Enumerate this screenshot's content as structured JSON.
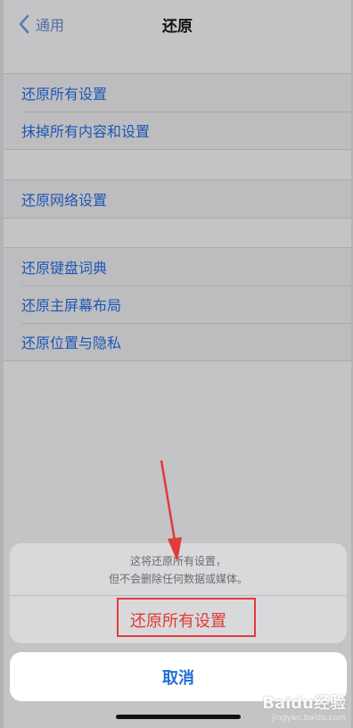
{
  "nav": {
    "back_label": "通用",
    "title": "还原"
  },
  "groups": [
    {
      "items": [
        "还原所有设置",
        "抹掉所有内容和设置"
      ]
    },
    {
      "items": [
        "还原网络设置"
      ]
    },
    {
      "items": [
        "还原键盘词典",
        "还原主屏幕布局",
        "还原位置与隐私"
      ]
    }
  ],
  "sheet": {
    "message_line1": "这将还原所有设置，",
    "message_line2": "但不会删除任何数据或媒体。",
    "action": "还原所有设置",
    "cancel": "取消"
  },
  "watermark": {
    "main": "Baidu经验",
    "url": "jingyan.baidu.com"
  },
  "colors": {
    "link": "#1f56b6",
    "destructive": "#e03a34",
    "annotation": "#e23b3b"
  }
}
